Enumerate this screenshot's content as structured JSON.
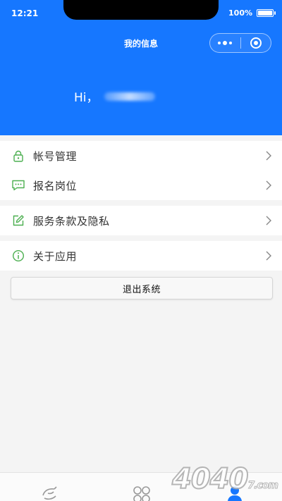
{
  "status_bar": {
    "time": "12:21",
    "battery": "100%"
  },
  "nav": {
    "title": "我的信息"
  },
  "profile": {
    "greeting": "Hi，"
  },
  "menu": {
    "group1": [
      {
        "label": "帐号管理",
        "icon": "lock-icon"
      },
      {
        "label": "报名岗位",
        "icon": "chat-bubble-icon"
      }
    ],
    "group2": [
      {
        "label": "服务条款及隐私",
        "icon": "edit-icon"
      }
    ],
    "group3": [
      {
        "label": "关于应用",
        "icon": "info-icon"
      }
    ]
  },
  "logout_label": "退出系统",
  "tabs": [
    {
      "icon": "home-icon"
    },
    {
      "icon": "apps-icon"
    },
    {
      "icon": "user-icon",
      "active": true
    }
  ],
  "watermark": {
    "text": "4040",
    "suffix": "7.com"
  },
  "colors": {
    "primary": "#1677ff",
    "icon_green": "#4caf50",
    "background": "#f4f4f4"
  }
}
